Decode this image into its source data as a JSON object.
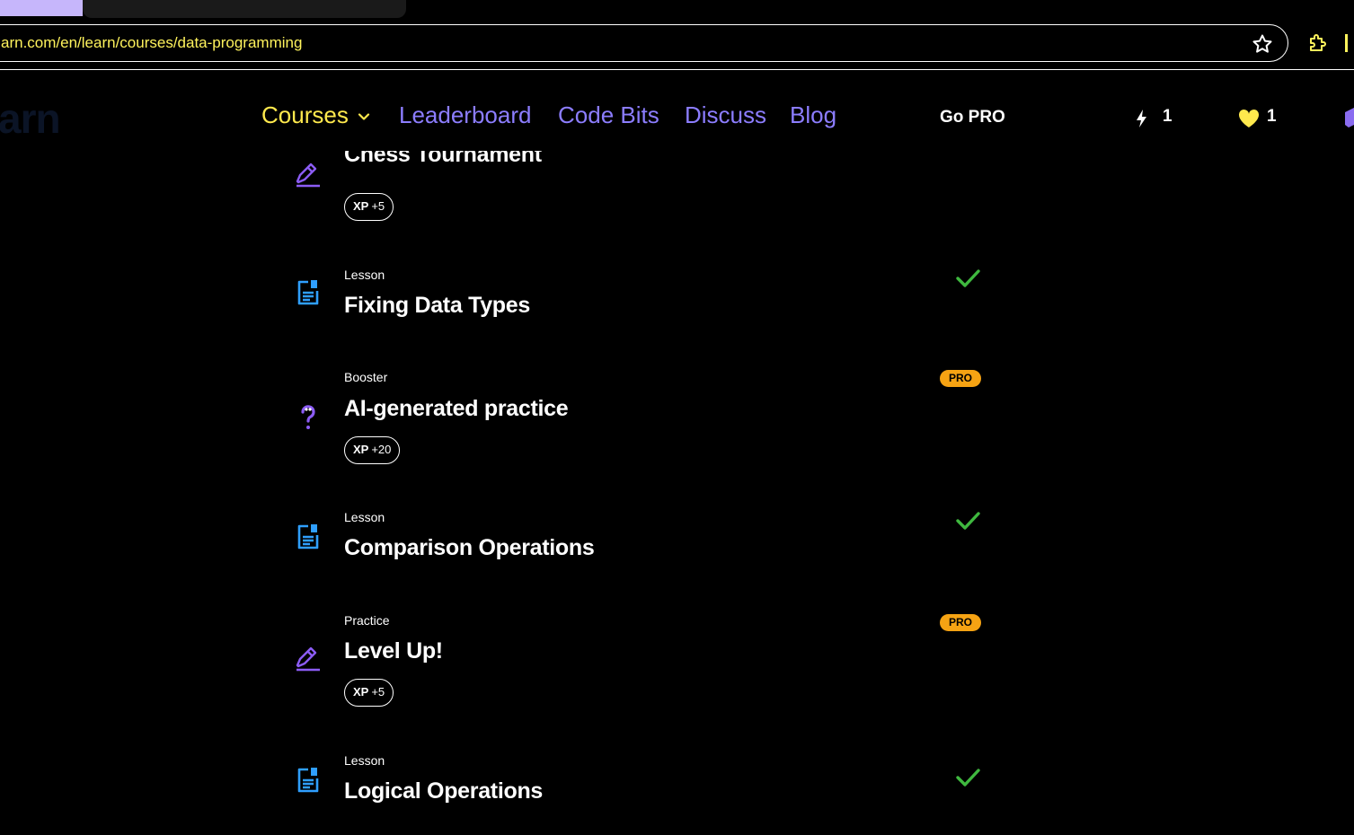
{
  "browser": {
    "tab_title": "",
    "url": "arn.com/en/learn/courses/data-programming",
    "star_icon": "star-icon",
    "extensions_icon": "puzzle-icon"
  },
  "site": {
    "logo_text": "arn",
    "nav": [
      {
        "label": "Courses",
        "icon": "chevron-down-icon",
        "active": true
      },
      {
        "label": "Leaderboard"
      },
      {
        "label": "Code Bits"
      },
      {
        "label": "Discuss"
      },
      {
        "label": "Blog"
      }
    ],
    "go_pro": "Go PRO",
    "streak": {
      "icon": "bolt-icon",
      "value": "1"
    },
    "hearts": {
      "icon": "heart-icon",
      "value": "1"
    },
    "gems_icon": "gem-icon"
  },
  "lessons": [
    {
      "type": "",
      "title": "Chess Tournament",
      "icon": "pencil-icon",
      "xp_label": "XP",
      "xp_value": "+5"
    },
    {
      "type": "Lesson",
      "title": "Fixing Data Types",
      "icon": "document-icon",
      "status": "completed"
    },
    {
      "type": "Booster",
      "title": "AI-generated practice",
      "icon": "question-icon",
      "xp_label": "XP",
      "xp_value": "+20",
      "badge": "PRO"
    },
    {
      "type": "Lesson",
      "title": "Comparison Operations",
      "icon": "document-icon",
      "status": "completed"
    },
    {
      "type": "Practice",
      "title": "Level Up!",
      "icon": "pencil-icon",
      "xp_label": "XP",
      "xp_value": "+5",
      "badge": "PRO"
    },
    {
      "type": "Lesson",
      "title": "Logical Operations",
      "icon": "document-icon",
      "status": "completed"
    }
  ],
  "colors": {
    "accent_nav": "#8c7dff",
    "active_nav": "#ffe94d",
    "check": "#3fb83f",
    "pro_badge": "#f6a313",
    "lesson_icon": "#2f9fff",
    "practice_icon": "#8c5cf5"
  }
}
